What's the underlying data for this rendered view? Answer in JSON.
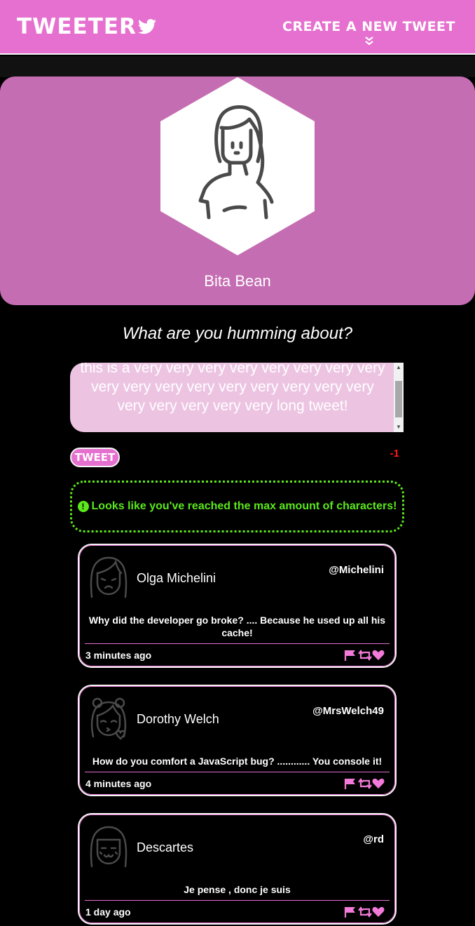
{
  "header": {
    "brand": "TWEETER",
    "compose_label": "CREATE A NEW TWEET",
    "accent_color": "#e670cf"
  },
  "profile": {
    "name": "Bita Bean",
    "background_color": "#c56db2"
  },
  "composer": {
    "prompt": "What are you humming about?",
    "text_value": "this is a very very very very very very very very very very very very very very very very very very very very very very long tweet!",
    "submit_label": "TWEET",
    "counter": "-1",
    "error_message": "Looks like you've reached the max amount of characters!",
    "error_color": "#5be81c"
  },
  "tweets": [
    {
      "name": "Olga Michelini",
      "handle": "@Michelini",
      "text": "Why did the developer go broke? .... Because he used up all his cache!",
      "time": "3 minutes ago",
      "avatar": "girl-sad-icon"
    },
    {
      "name": "Dorothy Welch",
      "handle": "@MrsWelch49",
      "text": "How do you comfort a JavaScript bug? ............ You console it!",
      "time": "4 minutes ago",
      "avatar": "girl-kiss-icon"
    },
    {
      "name": "Descartes",
      "handle": "@rd",
      "text": "Je pense , donc je suis",
      "time": "1 day ago",
      "avatar": "girl-cute-icon"
    }
  ]
}
